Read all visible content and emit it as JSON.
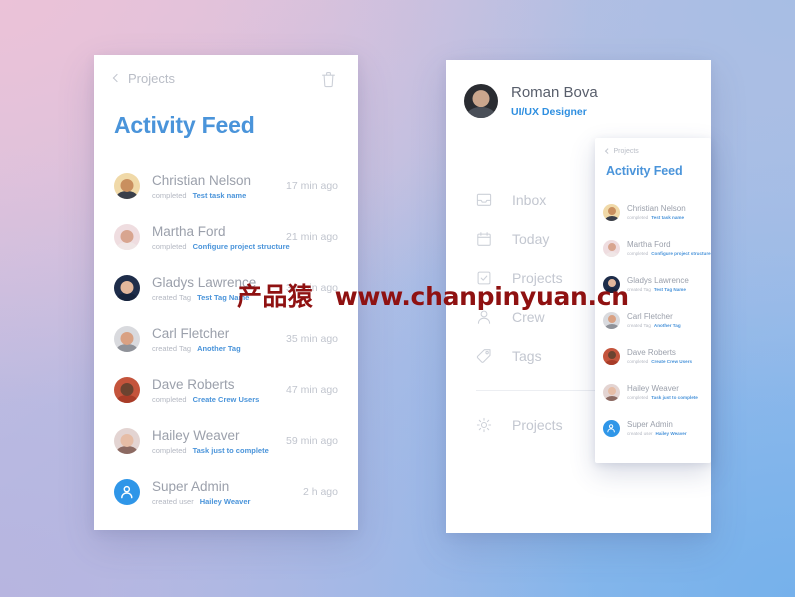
{
  "background": {
    "corner_top_left": "#ebc2d8",
    "corner_top_right": "#a7bee4",
    "corner_bottom_left": "#b7b5e0",
    "corner_bottom_right": "#76b1eb"
  },
  "theme": {
    "accent_blue": "#4a94da",
    "name_gray": "#9ba0ab",
    "meta_gray": "#c1c5ce",
    "admin_blue": "#2f96e8"
  },
  "left_panel": {
    "back_label": "Projects",
    "back_icon": "chevron-left-icon",
    "trash_icon": "trash-icon",
    "title": "Activity Feed",
    "items": [
      {
        "name": "Christian Nelson",
        "action": "completed",
        "target": "Test task name",
        "time": "17 min ago",
        "avatar": {
          "ring": "#f0d9a8",
          "face": "#c98f5f",
          "body": "#3a3f4a"
        }
      },
      {
        "name": "Martha Ford",
        "action": "completed",
        "target": "Configure project structure",
        "time": "21 min ago",
        "avatar": {
          "ring": "#efdde0",
          "face": "#d8a58f",
          "body": "#f0e6e6"
        }
      },
      {
        "name": "Gladys Lawrence",
        "action": "created Tag",
        "target": "Test Tag Name",
        "time": "34 min ago",
        "avatar": {
          "ring": "#1e2d4a",
          "face": "#e2b79c",
          "body": "#16233c"
        }
      },
      {
        "name": "Carl Fletcher",
        "action": "created Tag",
        "target": "Another Tag",
        "time": "35 min ago",
        "avatar": {
          "ring": "#d9dade",
          "face": "#d9a183",
          "body": "#8f9299"
        }
      },
      {
        "name": "Dave Roberts",
        "action": "completed",
        "target": "Create Crew Users",
        "time": "47 min ago",
        "avatar": {
          "ring": "#c4543c",
          "face": "#6b4330",
          "body": "#a83c28"
        }
      },
      {
        "name": "Hailey Weaver",
        "action": "completed",
        "target": "Task just to complete",
        "time": "59 min ago",
        "avatar": {
          "ring": "#e3d4d2",
          "face": "#e6bda6",
          "body": "#8c6a62"
        }
      },
      {
        "name": "Super Admin",
        "action": "created user",
        "target": "Hailey Weaver",
        "time": "2 h ago",
        "avatar": {
          "ring": "#2f96e8",
          "face": "#2f96e8",
          "body": "#2f96e8"
        },
        "is_admin": true
      }
    ]
  },
  "right_panel": {
    "profile": {
      "name": "Roman Bova",
      "role": "UI/UX Designer",
      "avatar_name": "profile-avatar"
    },
    "menu": [
      {
        "label": "Inbox",
        "icon": "inbox-icon"
      },
      {
        "label": "Today",
        "icon": "calendar-icon"
      },
      {
        "label": "Projects",
        "icon": "checkbox-icon"
      },
      {
        "label": "Crew",
        "icon": "person-icon"
      },
      {
        "label": "Tags",
        "icon": "tag-icon"
      }
    ],
    "menu_footer": [
      {
        "label": "Projects",
        "icon": "gear-icon"
      }
    ]
  },
  "mini_panel": {
    "back_label": "Projects",
    "back_icon": "chevron-left-icon",
    "title": "Activity Feed",
    "items": [
      {
        "name": "Christian Nelson",
        "action": "completed",
        "target": "Test task name",
        "avatar": {
          "ring": "#f0d9a8",
          "face": "#c98f5f",
          "body": "#3a3f4a"
        }
      },
      {
        "name": "Martha Ford",
        "action": "completed",
        "target": "Configure project structure",
        "avatar": {
          "ring": "#efdde0",
          "face": "#d8a58f",
          "body": "#f0e6e6"
        }
      },
      {
        "name": "Gladys Lawrence",
        "action": "created Tag",
        "target": "Test Tag Name",
        "avatar": {
          "ring": "#1e2d4a",
          "face": "#e2b79c",
          "body": "#16233c"
        }
      },
      {
        "name": "Carl Fletcher",
        "action": "created Tag",
        "target": "Another Tag",
        "avatar": {
          "ring": "#d9dade",
          "face": "#d9a183",
          "body": "#8f9299"
        }
      },
      {
        "name": "Dave Roberts",
        "action": "completed",
        "target": "Create Crew Users",
        "avatar": {
          "ring": "#c4543c",
          "face": "#6b4330",
          "body": "#a83c28"
        }
      },
      {
        "name": "Hailey Weaver",
        "action": "completed",
        "target": "Task just to complete",
        "avatar": {
          "ring": "#e3d4d2",
          "face": "#e6bda6",
          "body": "#8c6a62"
        }
      },
      {
        "name": "Super Admin",
        "action": "created user",
        "target": "Hailey Weaver",
        "avatar": {
          "ring": "#2f96e8",
          "face": "#2f96e8",
          "body": "#2f96e8"
        },
        "is_admin": true
      }
    ]
  },
  "watermark": {
    "zh": "产品猿",
    "en": "www.chanpinyuan.cn",
    "color": "#8f1111"
  }
}
